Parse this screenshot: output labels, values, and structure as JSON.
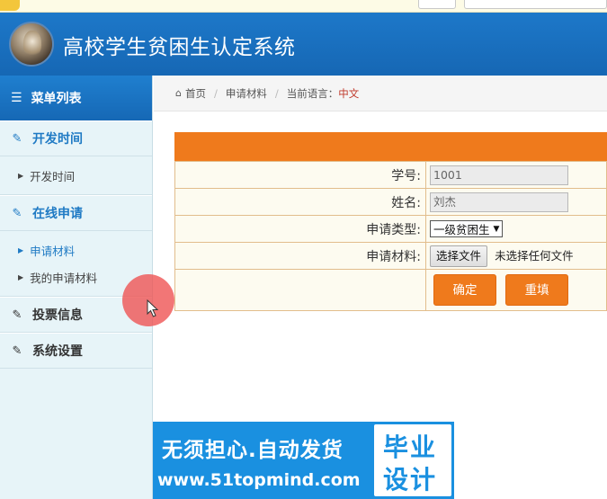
{
  "header": {
    "system_title": "高校学生贫困生认定系统"
  },
  "sidebar": {
    "menu_title": "菜单列表",
    "groups": [
      {
        "title": "开发时间",
        "items": [
          "开发时间"
        ]
      },
      {
        "title": "在线申请",
        "items": [
          "申请材料",
          "我的申请材料"
        ]
      },
      {
        "title": "投票信息",
        "items": []
      },
      {
        "title": "系统设置",
        "items": []
      }
    ],
    "active_item": "申请材料"
  },
  "breadcrumb": {
    "home": "首页",
    "current": "申请材料",
    "language_label": "当前语言：",
    "language_value": "中文"
  },
  "form": {
    "fields": [
      {
        "label": "学号:",
        "value": "1001"
      },
      {
        "label": "姓名:",
        "value": "刘杰"
      },
      {
        "label": "申请类型:",
        "selected": "一级贫困生"
      },
      {
        "label": "申请材料:",
        "file_button": "选择文件",
        "file_status": "未选择任何文件"
      }
    ],
    "confirm_label": "确定",
    "reset_label": "重填"
  },
  "banner": {
    "slogan": "无须担心.自动发货",
    "site": "www.51topmind.com",
    "badge_line1": "毕业",
    "badge_line2": "设计"
  },
  "colors": {
    "header_blue": "#1667b4",
    "sidebar_bg": "#e7f4f8",
    "accent_orange": "#ef7a1c",
    "banner_blue": "#1a90e0"
  }
}
